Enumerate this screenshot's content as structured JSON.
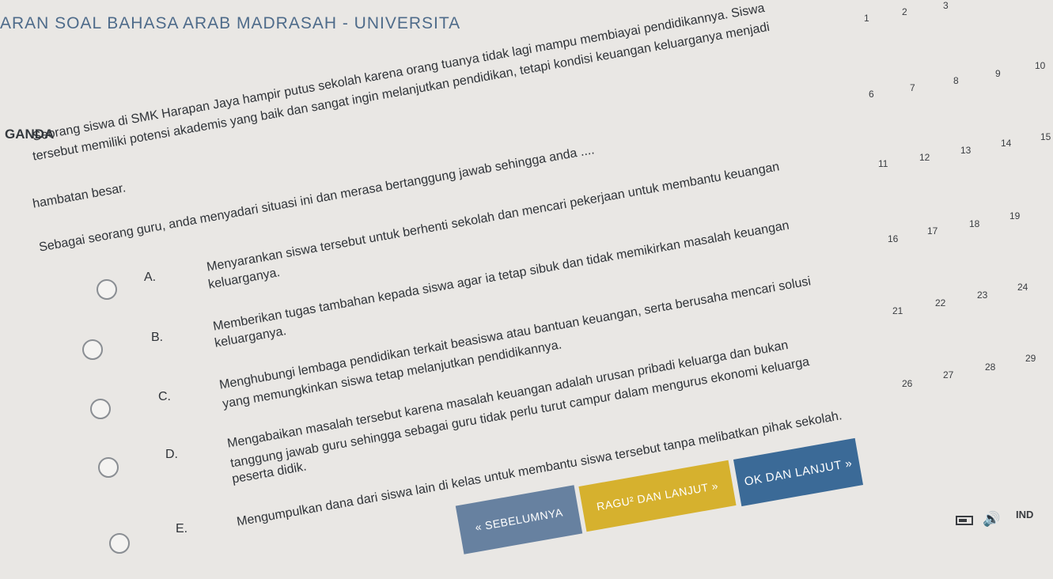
{
  "header": {
    "title": "ARAN SOAL BAHASA ARAB MADRASAH - UNIVERSITA"
  },
  "section": {
    "label": "GANDA"
  },
  "question": {
    "lines": [
      "Seorang siswa di SMK Harapan Jaya hampir putus sekolah karena orang tuanya tidak lagi mampu membiayai pendidikannya. Siswa",
      "tersebut memiliki potensi akademis yang baik dan sangat ingin melanjutkan pendidikan, tetapi kondisi keuangan keluarganya menjadi",
      "hambatan besar.",
      "Sebagai seorang guru, anda menyadari situasi ini dan merasa bertanggung jawab sehingga anda ...."
    ]
  },
  "options": [
    {
      "letter": "A.",
      "lines": [
        "Menyarankan siswa tersebut untuk berhenti sekolah dan mencari pekerjaan untuk membantu keuangan",
        "keluarganya."
      ]
    },
    {
      "letter": "B.",
      "lines": [
        "Memberikan tugas tambahan kepada siswa agar ia tetap sibuk dan tidak memikirkan masalah keuangan",
        "keluarganya."
      ]
    },
    {
      "letter": "C.",
      "lines": [
        "Menghubungi lembaga pendidikan terkait beasiswa atau bantuan keuangan, serta berusaha mencari solusi",
        "yang memungkinkan siswa tetap melanjutkan pendidikannya."
      ]
    },
    {
      "letter": "D.",
      "lines": [
        "Mengabaikan masalah tersebut karena masalah keuangan adalah urusan pribadi keluarga dan bukan",
        "tanggung jawab guru sehingga sebagai guru tidak perlu turut campur dalam mengurus ekonomi keluarga",
        "peserta didik."
      ]
    },
    {
      "letter": "E.",
      "lines": [
        "Mengumpulkan dana dari siswa lain di kelas untuk membantu siswa tersebut tanpa melibatkan pihak sekolah."
      ]
    }
  ],
  "navigation": {
    "prev_label": "« SEBELUMNYA",
    "ragu_label": "RAGU² DAN LANJUT »",
    "ok_label": "OK DAN LANJUT »"
  },
  "question_numbers": [
    "1",
    "2",
    "3",
    "6",
    "7",
    "8",
    "9",
    "10",
    "11",
    "12",
    "13",
    "14",
    "15",
    "16",
    "17",
    "18",
    "19",
    "21",
    "22",
    "23",
    "24",
    "26",
    "27",
    "28",
    "29"
  ],
  "status": {
    "language": "IND"
  },
  "icons": {
    "battery": "battery-icon",
    "speaker": "speaker-icon"
  }
}
